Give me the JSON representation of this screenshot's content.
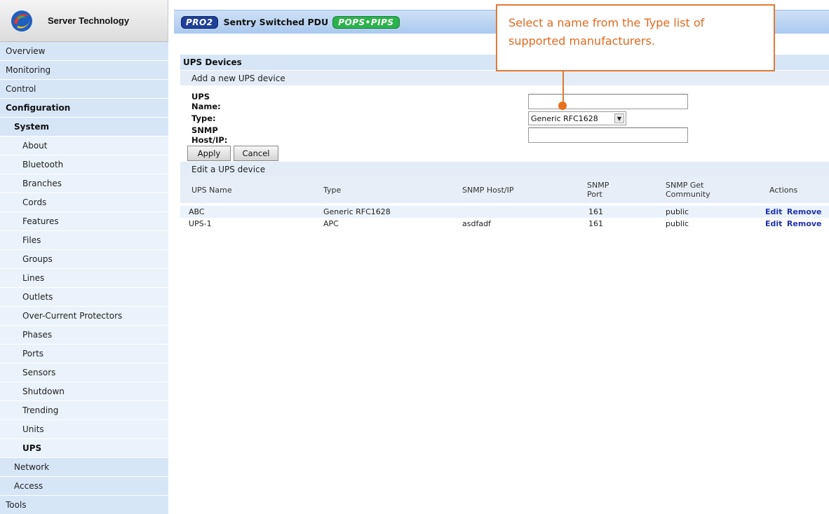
{
  "brand": {
    "title": "Server Technology"
  },
  "sidebar": {
    "items": [
      {
        "label": "Overview",
        "level": 1,
        "bold": false
      },
      {
        "label": "Monitoring",
        "level": 1,
        "bold": false
      },
      {
        "label": "Control",
        "level": 1,
        "bold": false
      },
      {
        "label": "Configuration",
        "level": 1,
        "bold": true
      },
      {
        "label": "System",
        "level": 2,
        "bold": true
      },
      {
        "label": "About",
        "level": 3,
        "bold": false
      },
      {
        "label": "Bluetooth",
        "level": 3,
        "bold": false
      },
      {
        "label": "Branches",
        "level": 3,
        "bold": false
      },
      {
        "label": "Cords",
        "level": 3,
        "bold": false
      },
      {
        "label": "Features",
        "level": 3,
        "bold": false
      },
      {
        "label": "Files",
        "level": 3,
        "bold": false
      },
      {
        "label": "Groups",
        "level": 3,
        "bold": false
      },
      {
        "label": "Lines",
        "level": 3,
        "bold": false
      },
      {
        "label": "Outlets",
        "level": 3,
        "bold": false
      },
      {
        "label": "Over-Current Protectors",
        "level": 3,
        "bold": false
      },
      {
        "label": "Phases",
        "level": 3,
        "bold": false
      },
      {
        "label": "Ports",
        "level": 3,
        "bold": false
      },
      {
        "label": "Sensors",
        "level": 3,
        "bold": false
      },
      {
        "label": "Shutdown",
        "level": 3,
        "bold": false
      },
      {
        "label": "Trending",
        "level": 3,
        "bold": false
      },
      {
        "label": "Units",
        "level": 3,
        "bold": false
      },
      {
        "label": "UPS",
        "level": 3,
        "bold": true
      },
      {
        "label": "Network",
        "level": 2,
        "bold": false
      },
      {
        "label": "Access",
        "level": 2,
        "bold": false
      },
      {
        "label": "Tools",
        "level": 1,
        "bold": false
      }
    ]
  },
  "header": {
    "pro_badge": "PRO2",
    "title": "Sentry Switched PDU",
    "pops_badge": "POPS•PIPS"
  },
  "main": {
    "section_title": "UPS Devices",
    "add_title": "Add a new UPS device",
    "form": {
      "name_label": "UPS Name:",
      "name_value": "",
      "type_label": "Type:",
      "type_value": "Generic RFC1628",
      "host_label": "SNMP Host/IP:",
      "host_value": "",
      "apply_label": "Apply",
      "cancel_label": "Cancel"
    },
    "edit_title": "Edit a UPS device",
    "table": {
      "headers": [
        "UPS Name",
        "Type",
        "SNMP Host/IP",
        "SNMP Port",
        "SNMP Get Community",
        "Actions"
      ],
      "rows": [
        {
          "name": "ABC",
          "type": "Generic RFC1628",
          "host": "",
          "port": "161",
          "community": "public",
          "edit": "Edit",
          "remove": "Remove"
        },
        {
          "name": "UPS-1",
          "type": "APC",
          "host": "asdfadf",
          "port": "161",
          "community": "public",
          "edit": "Edit",
          "remove": "Remove"
        }
      ]
    }
  },
  "callout": {
    "text": "Select a name from the Type list of supported manufacturers."
  },
  "colors": {
    "nav_bg": "#d6e6f7",
    "header_bg": "#a9c9ee",
    "callout_orange": "#e07a35",
    "link_blue": "#2233aa"
  }
}
